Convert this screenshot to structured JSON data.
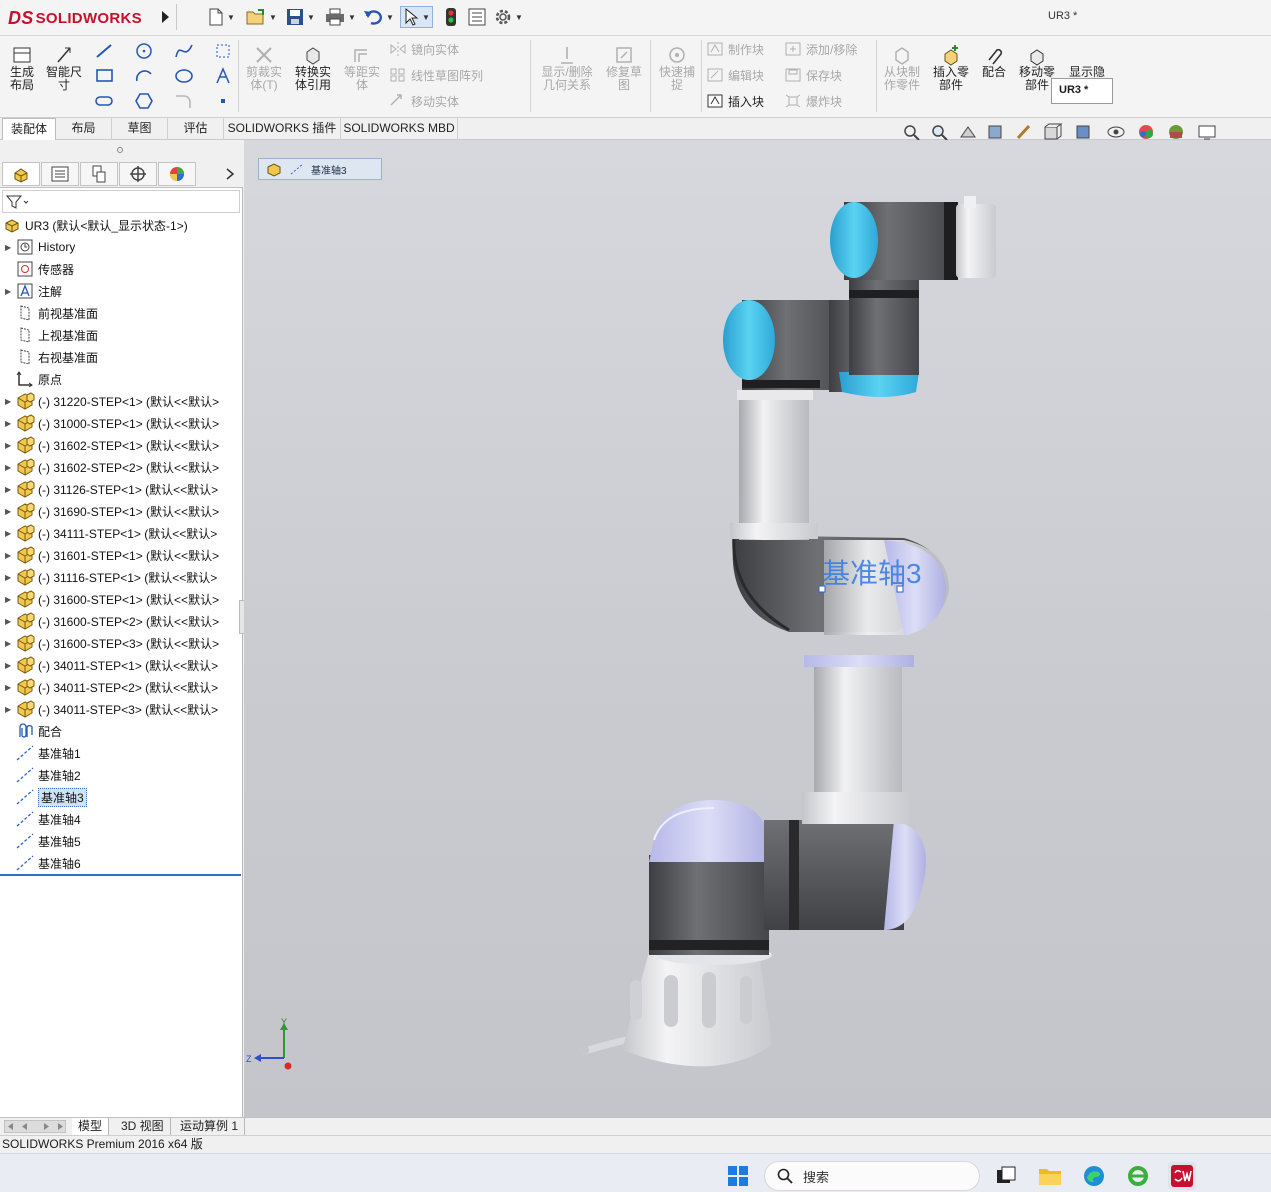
{
  "app": {
    "brand": "SOLIDWORKS",
    "brand_prefix": "DS",
    "document_title": "UR3 *",
    "status_text": "SOLIDWORKS Premium 2016 x64 版"
  },
  "ribbon": {
    "generate_layout": "生成布局",
    "smart_dimension": "智能尺寸",
    "trim_entities": "剪裁实体(T)",
    "convert_entities": "转换实体引用",
    "offset_entities": "等距实体",
    "mirror_entities": "镜向实体",
    "linear_pattern": "线性草图阵列",
    "move_entities": "移动实体",
    "display_delete_relations": "显示/删除几何关系",
    "repair_sketch": "修复草图",
    "quick_snaps": "快速捕捉",
    "make_block": "制作块",
    "edit_block": "编辑块",
    "insert_block": "插入块",
    "add_remove": "添加/移除",
    "save_block": "保存块",
    "explode_block": "爆炸块",
    "make_part_from_block": "从块制作零件",
    "insert_components": "插入零部件",
    "mate": "配合",
    "move_component": "移动零部件",
    "show_hidden_components": "显示隐藏的零部件",
    "popup_title": "UR3 *"
  },
  "tabs": [
    "装配体",
    "布局",
    "草图",
    "评估",
    "SOLIDWORKS 插件",
    "SOLIDWORKS MBD"
  ],
  "tree": {
    "root": "UR3 (默认<默认_显示状态-1>)",
    "items": [
      {
        "label": "History",
        "icon": "history-icon",
        "expandable": true
      },
      {
        "label": "传感器",
        "icon": "sensor-icon",
        "expandable": false
      },
      {
        "label": "注解",
        "icon": "annotation-icon",
        "expandable": true
      },
      {
        "label": "前视基准面",
        "icon": "plane-icon",
        "expandable": false
      },
      {
        "label": "上视基准面",
        "icon": "plane-icon",
        "expandable": false
      },
      {
        "label": "右视基准面",
        "icon": "plane-icon",
        "expandable": false
      },
      {
        "label": "原点",
        "icon": "origin-icon",
        "expandable": false
      },
      {
        "label": "(-) 31220-STEP<1> (默认<<默认>",
        "icon": "part-icon",
        "expandable": true
      },
      {
        "label": "(-) 31000-STEP<1> (默认<<默认>",
        "icon": "part-icon",
        "expandable": true
      },
      {
        "label": "(-) 31602-STEP<1> (默认<<默认>",
        "icon": "part-icon",
        "expandable": true
      },
      {
        "label": "(-) 31602-STEP<2> (默认<<默认>",
        "icon": "part-icon",
        "expandable": true
      },
      {
        "label": "(-) 31126-STEP<1> (默认<<默认>",
        "icon": "part-icon",
        "expandable": true
      },
      {
        "label": "(-) 31690-STEP<1> (默认<<默认>",
        "icon": "part-icon",
        "expandable": true
      },
      {
        "label": "(-) 34111-STEP<1> (默认<<默认>",
        "icon": "part-icon",
        "expandable": true
      },
      {
        "label": "(-) 31601-STEP<1> (默认<<默认>",
        "icon": "part-icon",
        "expandable": true
      },
      {
        "label": "(-) 31116-STEP<1> (默认<<默认>",
        "icon": "part-icon",
        "expandable": true
      },
      {
        "label": "(-) 31600-STEP<1> (默认<<默认>",
        "icon": "part-icon",
        "expandable": true
      },
      {
        "label": "(-) 31600-STEP<2> (默认<<默认>",
        "icon": "part-icon",
        "expandable": true
      },
      {
        "label": "(-) 31600-STEP<3> (默认<<默认>",
        "icon": "part-icon",
        "expandable": true
      },
      {
        "label": "(-) 34011-STEP<1> (默认<<默认>",
        "icon": "part-icon",
        "expandable": true
      },
      {
        "label": "(-) 34011-STEP<2> (默认<<默认>",
        "icon": "part-icon",
        "expandable": true
      },
      {
        "label": "(-) 34011-STEP<3> (默认<<默认>",
        "icon": "part-icon",
        "expandable": true
      },
      {
        "label": "配合",
        "icon": "mates-icon",
        "expandable": false
      },
      {
        "label": "基准轴1",
        "icon": "axis-icon",
        "expandable": false
      },
      {
        "label": "基准轴2",
        "icon": "axis-icon",
        "expandable": false
      },
      {
        "label": "基准轴3",
        "icon": "axis-icon",
        "expandable": false,
        "selected": true
      },
      {
        "label": "基准轴4",
        "icon": "axis-icon",
        "expandable": false
      },
      {
        "label": "基准轴5",
        "icon": "axis-icon",
        "expandable": false
      },
      {
        "label": "基准轴6",
        "icon": "axis-icon",
        "expandable": false
      }
    ]
  },
  "viewport": {
    "breadcrumb": "基准轴3",
    "axis_label": "基准轴3",
    "triad": {
      "y": "Y",
      "z": "Z"
    }
  },
  "bottom_tabs": [
    "模型",
    "3D 视图",
    "运动算例 1"
  ],
  "taskbar": {
    "search_placeholder": "搜索"
  },
  "colors": {
    "brand_red": "#c8102e",
    "arm_dark": "#5e5f62",
    "arm_light": "#d5d6d9",
    "cap_blue": "#3ab8e0",
    "selection_lavender": "#c7c8ee",
    "axis_label_blue": "#3d7fe0"
  }
}
